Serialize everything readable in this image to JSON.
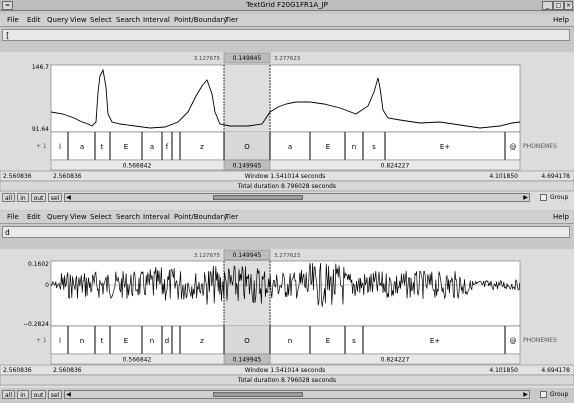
{
  "window": {
    "title": "TextGrid F20G1FR1A_JP"
  },
  "menu": [
    "File",
    "Edit",
    "Query",
    "View",
    "Select",
    "Search",
    "Interval",
    "Point/Boundary",
    "Tier"
  ],
  "help": "Help",
  "panels": [
    {
      "input_value": "[",
      "sel_left": "3.127675",
      "sel_mid": "0.149845",
      "sel_right": "3.277623",
      "signal_top": "146.7",
      "signal_bot": "91.64",
      "tier_num": "+ 1",
      "tier_name": "PHONEMES",
      "phonemes": [
        "l",
        "a",
        "t",
        "E",
        "a",
        "f",
        "z",
        "O",
        "a",
        "E",
        "n",
        "s",
        "E+",
        "@"
      ],
      "dur_left": "0.566842",
      "dur_mid": "0.149945",
      "dur_right": "0.824227",
      "t_left_a": "2.560836",
      "t_left_b": "2.560836",
      "window_text": "Window 1.541014 seconds",
      "t_right_a": "4.101850",
      "t_right_b": "4.694178",
      "total_text": "Total duration 8.796028 seconds",
      "btns": [
        "all",
        "in",
        "out",
        "sel"
      ],
      "group": "Group"
    },
    {
      "input_value": "d",
      "sel_left": "3.127675",
      "sel_mid": "0.149945",
      "sel_right": "3.277623",
      "signal_top": "0.1602",
      "signal_mid": "0",
      "signal_bot": "−0.2824",
      "tier_num": "+ 1",
      "tier_name": "PHONEMES",
      "phonemes": [
        "l",
        "n",
        "t",
        "E",
        "n",
        "d",
        "z",
        "O",
        "n",
        "E",
        "s",
        "E+",
        "@"
      ],
      "dur_left": "0.566842",
      "dur_mid": "0.149945",
      "dur_right": "0.824227",
      "t_left_a": "2.560836",
      "t_left_b": "2.560836",
      "window_text": "Window 1.541014 seconds",
      "t_right_a": "4.101850",
      "t_right_b": "4.694178",
      "total_text": "Total duration 8.796028 seconds",
      "btns": [
        "all",
        "in",
        "out",
        "sel"
      ],
      "group": "Group"
    }
  ],
  "colors": {
    "selection": "#bdbdbd",
    "wave": "#000000",
    "background": "#ffffff",
    "chrome": "#c8c8c8"
  }
}
